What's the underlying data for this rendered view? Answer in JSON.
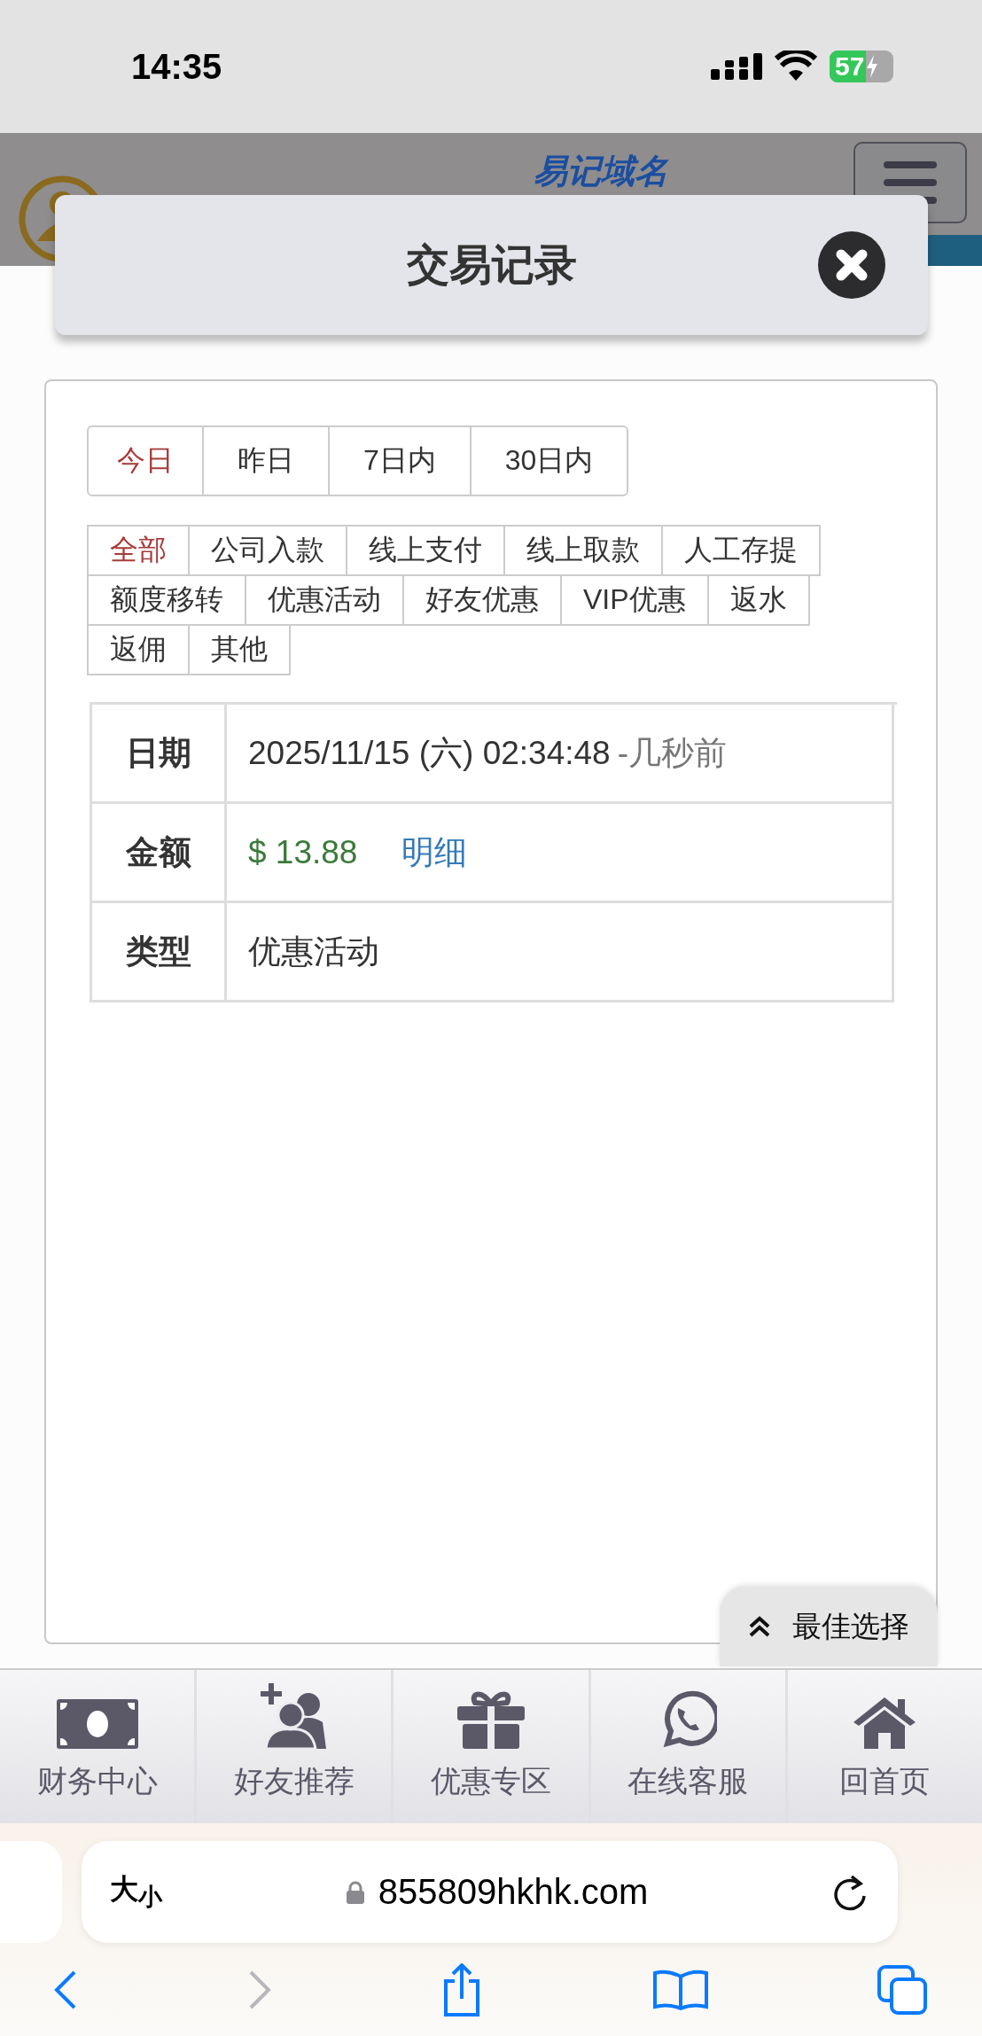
{
  "status_bar": {
    "time": "14:35",
    "battery": "57"
  },
  "site_header": {
    "domain_note": "易记域名"
  },
  "modal": {
    "title": "交易记录"
  },
  "date_tabs": [
    {
      "label": "今日",
      "selected": true
    },
    {
      "label": "昨日",
      "selected": false
    },
    {
      "label": "7日内",
      "selected": false
    },
    {
      "label": "30日内",
      "selected": false
    }
  ],
  "type_filters": [
    {
      "label": "全部",
      "selected": true
    },
    {
      "label": "公司入款",
      "selected": false
    },
    {
      "label": "线上支付",
      "selected": false
    },
    {
      "label": "线上取款",
      "selected": false
    },
    {
      "label": "人工存提",
      "selected": false
    },
    {
      "label": "额度移转",
      "selected": false
    },
    {
      "label": "优惠活动",
      "selected": false
    },
    {
      "label": "好友优惠",
      "selected": false
    },
    {
      "label": "VIP优惠",
      "selected": false
    },
    {
      "label": "返水",
      "selected": false
    },
    {
      "label": "返佣",
      "selected": false
    },
    {
      "label": "其他",
      "selected": false
    }
  ],
  "record": {
    "date_label": "日期",
    "date": "2025/11/15 (六) 02:34:48",
    "date_relative": "-几秒前",
    "amount_label": "金额",
    "amount": "$ 13.88",
    "detail_link": "明细",
    "type_label": "类型",
    "type": "优惠活动"
  },
  "float_button": {
    "label": "最佳选择"
  },
  "bottom_nav": [
    {
      "label": "财务中心",
      "kind": "money"
    },
    {
      "label": "好友推荐",
      "kind": "invite"
    },
    {
      "label": "优惠专区",
      "kind": "gift"
    },
    {
      "label": "在线客服",
      "kind": "chat"
    },
    {
      "label": "回首页",
      "kind": "home"
    }
  ],
  "browser": {
    "text_size": "大$_{小}$",
    "url": "855809hkhk.com",
    "back_disabled": false,
    "forward_disabled": true
  }
}
